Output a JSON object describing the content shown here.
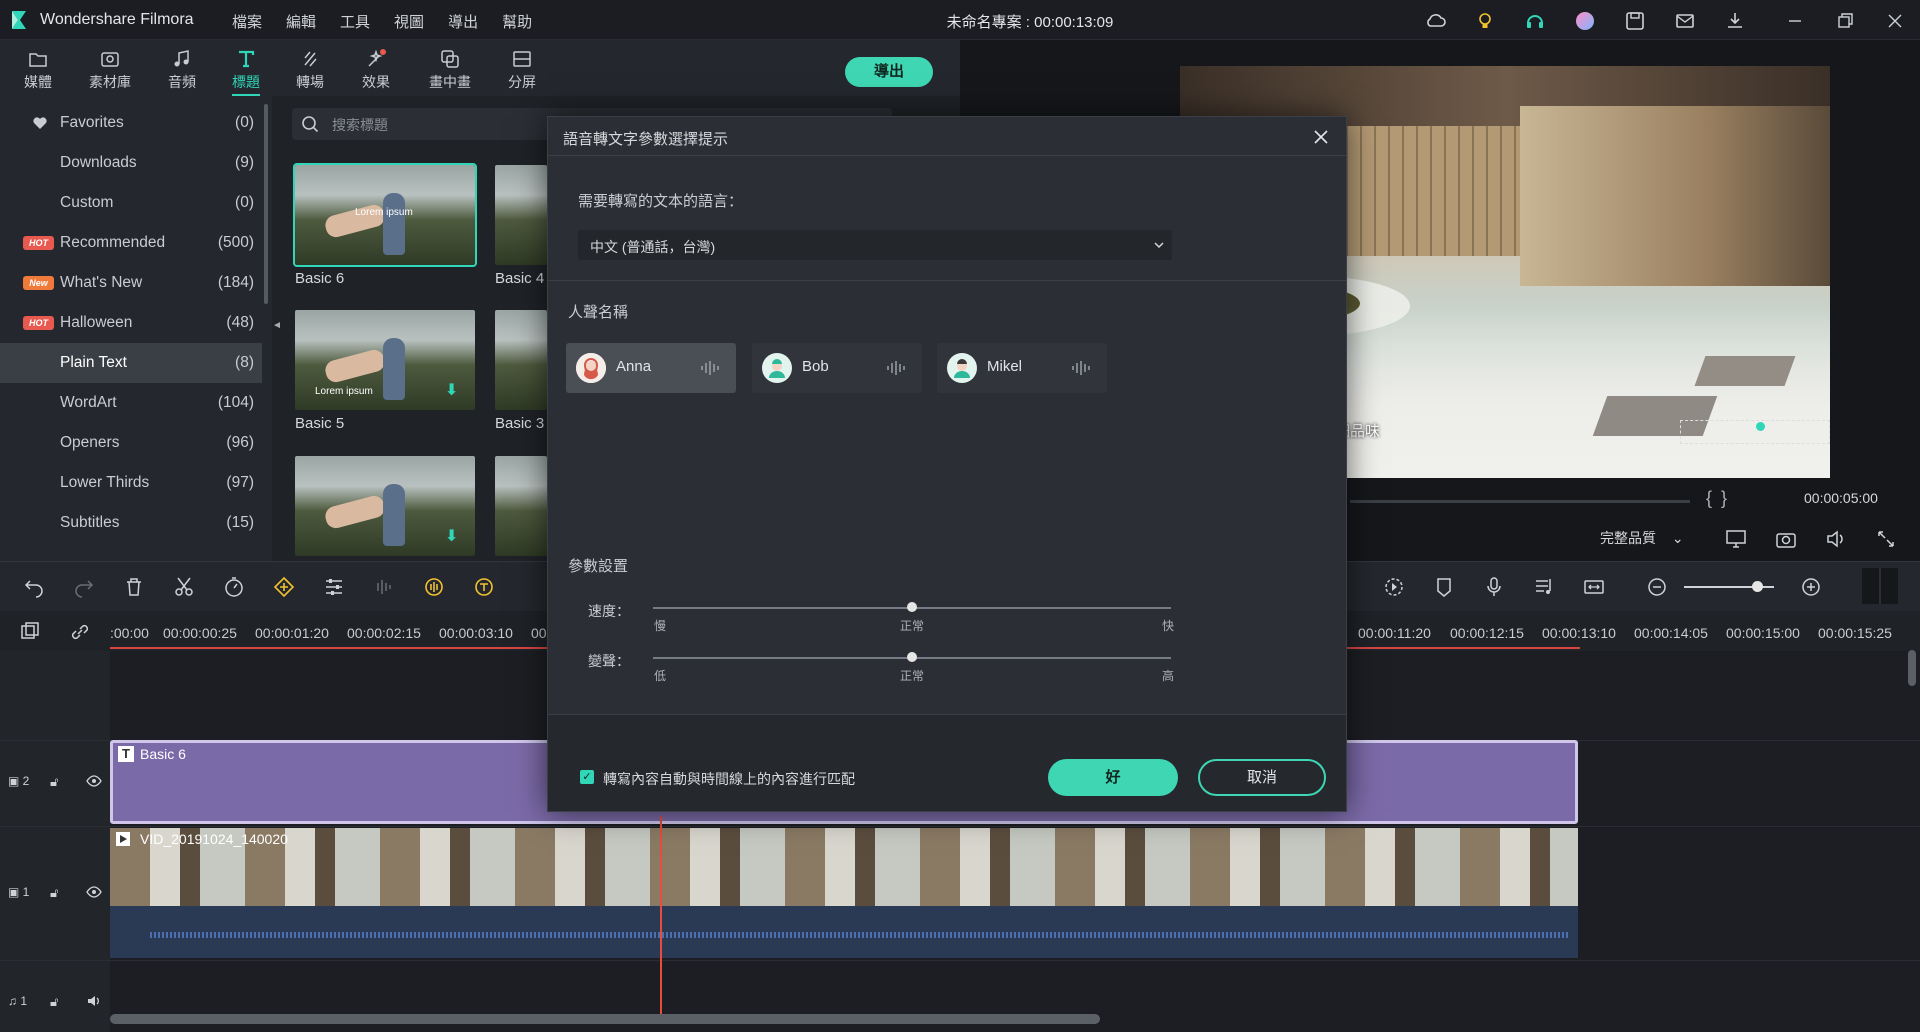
{
  "app": {
    "name": "Wondershare Filmora",
    "project_title": "未命名專案 : 00:00:13:09"
  },
  "menus": [
    "檔案",
    "編輯",
    "工具",
    "視圖",
    "導出",
    "幫助"
  ],
  "toolbar": {
    "tabs": [
      {
        "label": "媒體",
        "icon": "media-icon"
      },
      {
        "label": "素材庫",
        "icon": "stock-icon"
      },
      {
        "label": "音頻",
        "icon": "music-icon"
      },
      {
        "label": "標題",
        "icon": "title-icon",
        "active": true
      },
      {
        "label": "轉場",
        "icon": "transition-icon"
      },
      {
        "label": "效果",
        "icon": "effects-icon"
      },
      {
        "label": "畫中畫",
        "icon": "pip-icon"
      },
      {
        "label": "分屏",
        "icon": "split-screen-icon"
      }
    ],
    "export_label": "導出"
  },
  "sidebar": {
    "items": [
      {
        "label": "Favorites",
        "count": "(0)",
        "icon": "heart-icon"
      },
      {
        "label": "Downloads",
        "count": "(9)"
      },
      {
        "label": "Custom",
        "count": "(0)"
      },
      {
        "label": "Recommended",
        "count": "(500)",
        "badge": "HOT"
      },
      {
        "label": "What's New",
        "count": "(184)",
        "badge": "New"
      },
      {
        "label": "Halloween",
        "count": "(48)",
        "badge": "HOT"
      },
      {
        "label": "Plain Text",
        "count": "(8)",
        "selected": true
      },
      {
        "label": "WordArt",
        "count": "(104)"
      },
      {
        "label": "Openers",
        "count": "(96)"
      },
      {
        "label": "Lower Thirds",
        "count": "(97)"
      },
      {
        "label": "Subtitles",
        "count": "(15)"
      }
    ]
  },
  "search": {
    "placeholder": "搜索標題"
  },
  "thumbnails": [
    {
      "label": "Basic 6",
      "overlay": "Lorem ipsum",
      "selected": true
    },
    {
      "label": "Basic 4"
    },
    {
      "label": "Basic 5",
      "overlay": "Lorem ipsum"
    },
    {
      "label": "Basic 3"
    }
  ],
  "preview": {
    "timecode": "00:00:05:00",
    "quality": "完整品質",
    "subtitle_text": "真的好美，還往…都很細細品味",
    "brackets": "{   }"
  },
  "ruler": {
    "left_ticks": [
      ":00:00",
      "00:00:00:25",
      "00:00:01:20",
      "00:00:02:15",
      "00:00:03:10",
      "00"
    ],
    "right_ticks": [
      "00:00:11:20",
      "00:00:12:15",
      "00:00:13:10",
      "00:00:14:05",
      "00:00:15:00",
      "00:00:15:25"
    ]
  },
  "timeline": {
    "title_clip": "Basic 6",
    "video_clip": "VID_20191024_140020",
    "track_labels": [
      "2",
      "1",
      "1"
    ]
  },
  "dialog": {
    "title": "語音轉文字參數選擇提示",
    "language_question": "需要轉寫的文本的語言：",
    "language_value": "中文 (普通話，台灣)",
    "voice_label": "人聲名稱",
    "voices": [
      {
        "name": "Anna",
        "selected": true
      },
      {
        "name": "Bob"
      },
      {
        "name": "Mikel"
      }
    ],
    "params_label": "參數設置",
    "speed": {
      "label": "速度：",
      "min": "慢",
      "mid": "正常",
      "max": "快",
      "value": 0.5
    },
    "pitch": {
      "label": "變聲：",
      "min": "低",
      "mid": "正常",
      "max": "高",
      "value": 0.5
    },
    "checkbox_label": "轉寫內容自動與時間線上的內容進行匹配",
    "checkbox_checked": true,
    "ok_label": "好",
    "cancel_label": "取消"
  },
  "colors": {
    "accent": "#3ed6b3",
    "title_clip": "#7b6aa8",
    "playhead": "#e74c3c"
  }
}
